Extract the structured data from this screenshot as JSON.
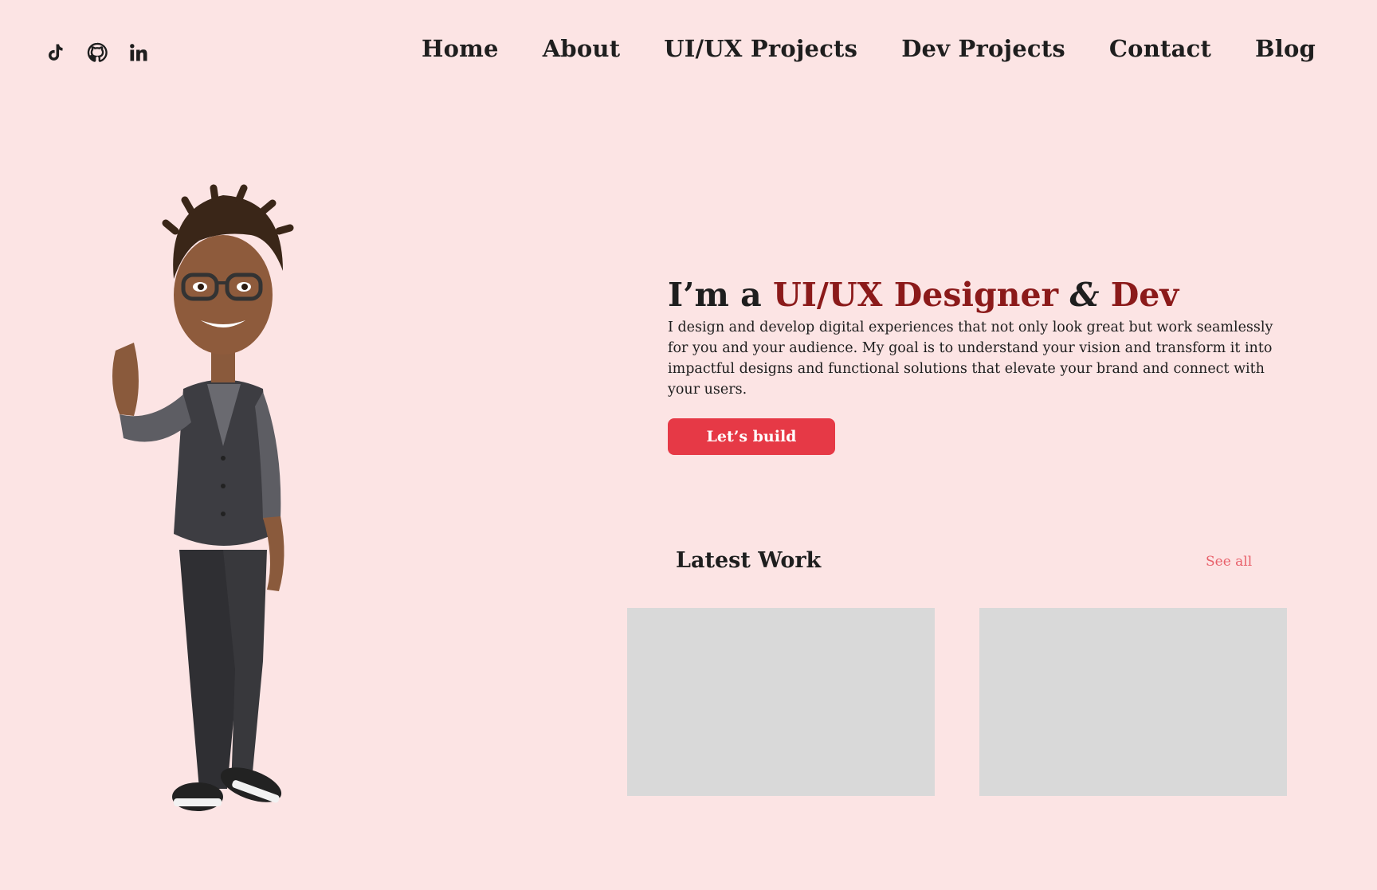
{
  "social": {
    "icons": [
      "tiktok-icon",
      "github-icon",
      "linkedin-icon"
    ]
  },
  "nav": {
    "items": [
      {
        "label": "Home"
      },
      {
        "label": "About"
      },
      {
        "label": "UI/UX Projects"
      },
      {
        "label": "Dev Projects"
      },
      {
        "label": "Contact"
      },
      {
        "label": "Blog"
      }
    ]
  },
  "hero": {
    "heading_prefix": "I’m a ",
    "heading_role": "UI/UX Designer",
    "heading_amp": " & ",
    "heading_dev": "Dev",
    "description": "I design and develop digital experiences that not only look great but work seamlessly for you and your audience. My goal is to understand your vision and transform it into impactful designs and functional solutions that elevate your brand and connect with your users.",
    "cta_label": "Let’s build"
  },
  "latest_work": {
    "title": "Latest Work",
    "see_all_label": "See all"
  },
  "colors": {
    "background": "#fce4e4",
    "accent_dark_red": "#8b1a1a",
    "cta_red": "#e63946",
    "see_all": "#e8606a",
    "card_placeholder": "#d9d9d9"
  }
}
